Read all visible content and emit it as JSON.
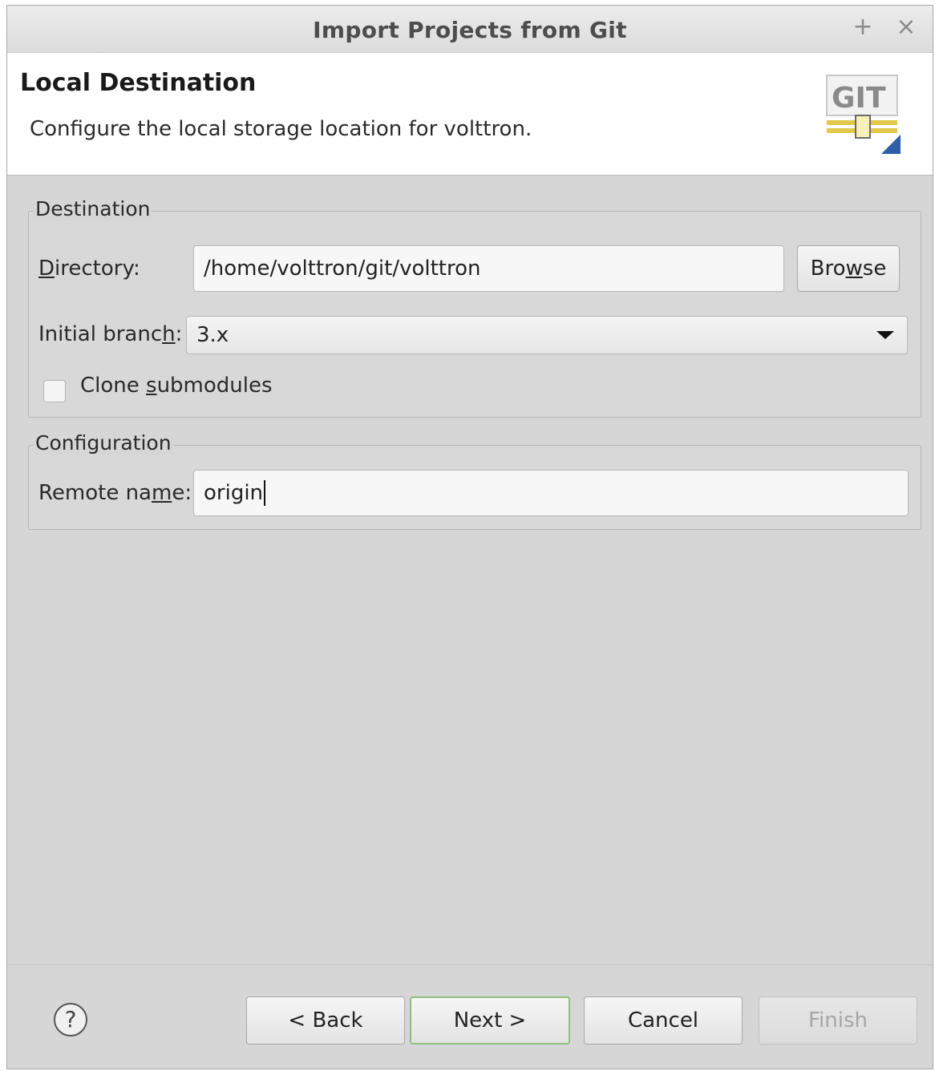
{
  "window": {
    "title": "Import Projects from Git",
    "maximize_glyph": "+",
    "close_glyph": "×"
  },
  "header": {
    "title": "Local Destination",
    "description": "Configure the local storage location for volttron."
  },
  "destination": {
    "legend": "Destination",
    "directory_label_pre": "",
    "directory_label_mnemonic": "D",
    "directory_label_post": "irectory:",
    "directory_value": "/home/volttron/git/volttron",
    "browse_pre": "Bro",
    "browse_mnemonic": "w",
    "browse_post": "se",
    "branch_label_pre": "Initial branc",
    "branch_label_mnemonic": "h",
    "branch_label_post": ":",
    "branch_value": "3.x",
    "clone_pre": "Clone ",
    "clone_mnemonic": "s",
    "clone_post": "ubmodules",
    "clone_checked": false
  },
  "configuration": {
    "legend": "Configuration",
    "remote_label_pre": "Remote na",
    "remote_label_mnemonic": "m",
    "remote_label_post": "e:",
    "remote_value": "origin"
  },
  "footer": {
    "help_glyph": "?",
    "back_label": "< Back",
    "next_label": "Next >",
    "cancel_label": "Cancel",
    "finish_label": "Finish"
  },
  "logo": {
    "text": "GIT"
  }
}
